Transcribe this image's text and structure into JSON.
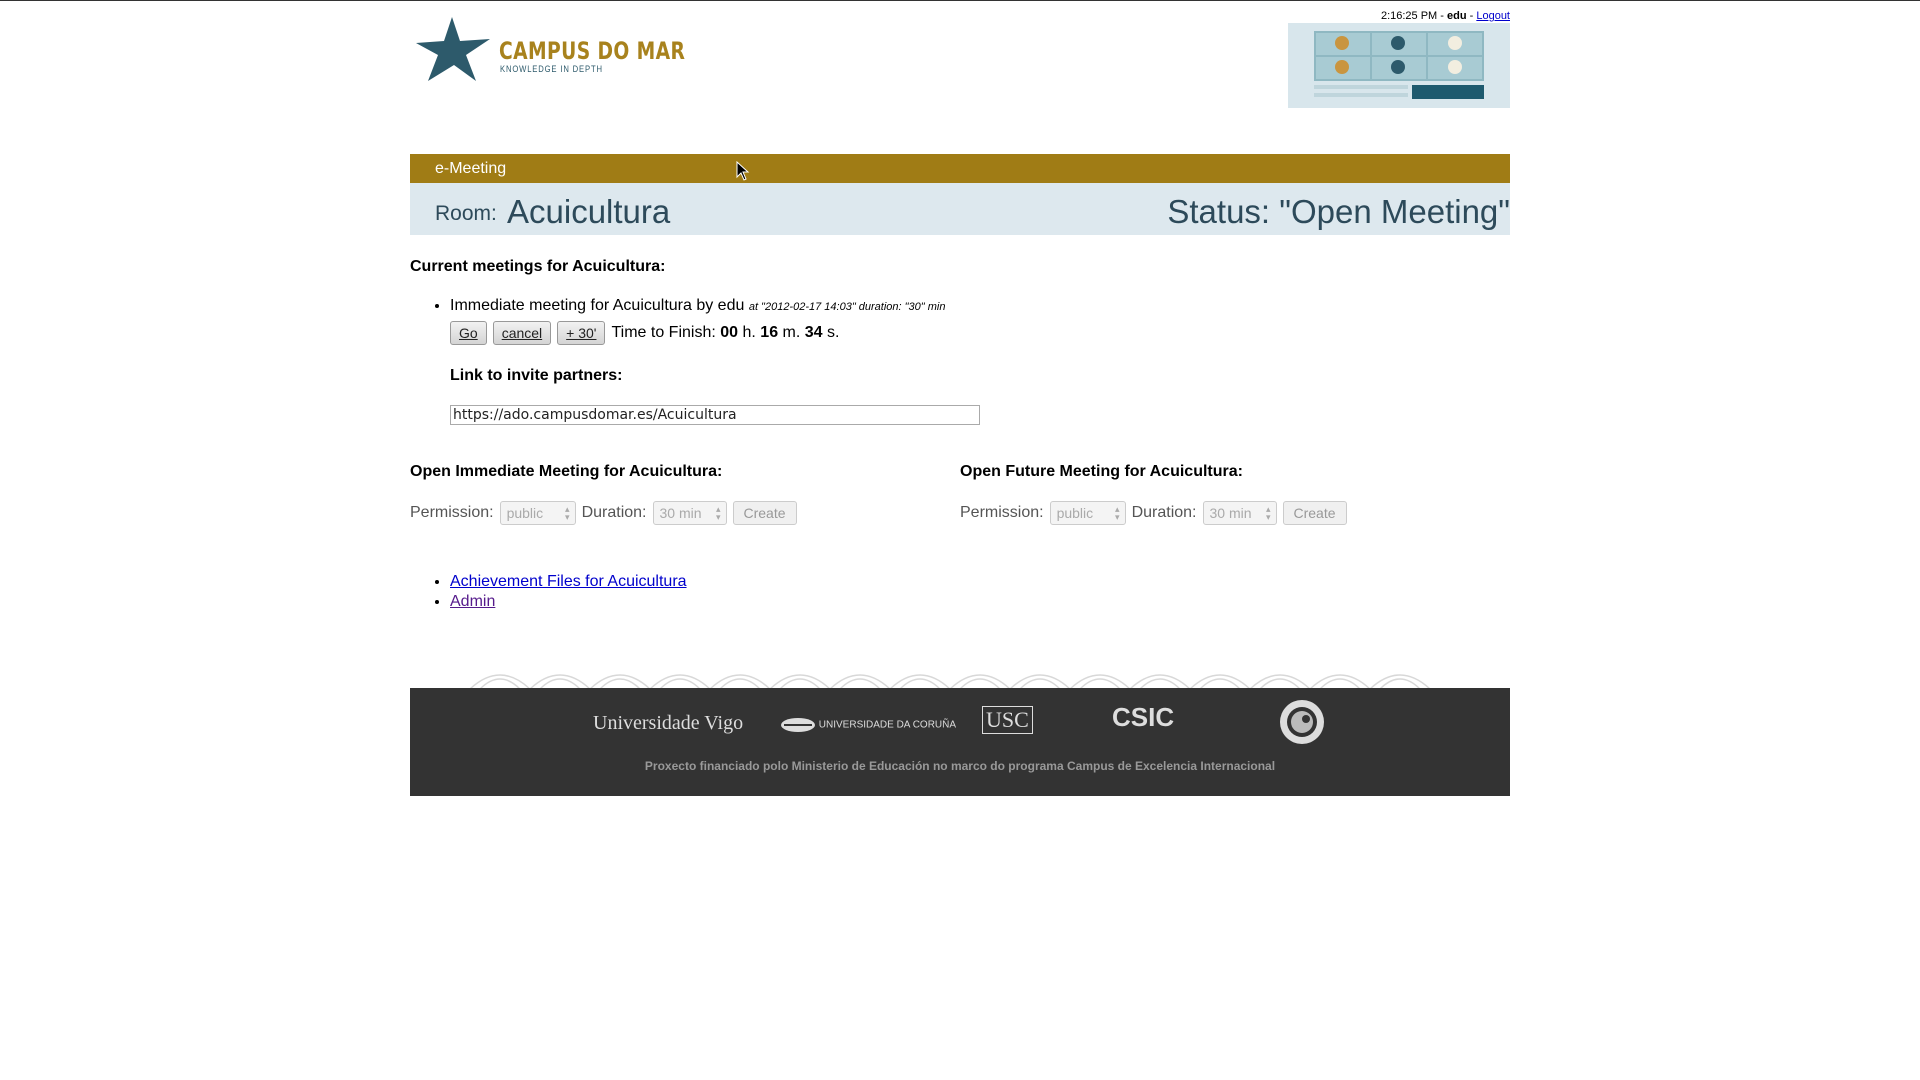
{
  "header": {
    "logo_main": "CAMPUS DO MAR",
    "logo_sub": "KNOWLEDGE IN DEPTH",
    "time": "2:16:25 PM",
    "user": "edu",
    "logout_label": "Logout"
  },
  "section": {
    "title": "e-Meeting"
  },
  "room": {
    "label": "Room:",
    "name": "Acuicultura",
    "status": "Status: \"Open Meeting\""
  },
  "current": {
    "heading": "Current meetings for Acuicultura:",
    "meeting_title": "Immediate meeting for Acuicultura by edu",
    "meeting_meta": "at \"2012-02-17 14:03\" duration: \"30\" min",
    "go_label": "Go",
    "cancel_label": "cancel",
    "extend_label": "+ 30'",
    "finish_label": "Time to Finish:",
    "hours": "00",
    "h_unit": "h.",
    "minutes": "16",
    "m_unit": "m.",
    "seconds": "34",
    "s_unit": "s.",
    "invite_heading": "Link to invite partners:",
    "invite_url": "https://ado.campusdomar.es/Acuicultura"
  },
  "immediate": {
    "heading": "Open Immediate Meeting for Acuicultura:",
    "permission_label": "Permission:",
    "permission_value": "public",
    "duration_label": "Duration:",
    "duration_value": "30 min",
    "create_label": "Create"
  },
  "future": {
    "heading": "Open Future Meeting for Acuicultura:",
    "permission_label": "Permission:",
    "permission_value": "public",
    "duration_label": "Duration:",
    "duration_value": "30 min",
    "create_label": "Create"
  },
  "links": {
    "achievement": "Achievement Files for Acuicultura",
    "admin": "Admin"
  },
  "footer": {
    "uvigo": "Universidade Vigo",
    "udc": "UNIVERSIDADE DA CORUÑA",
    "usc": "USC",
    "csic": "CSIC",
    "note": "Proxecto financiado polo Ministerio de Educación no marco do programa Campus de Excelencia Internacional"
  },
  "colors": {
    "brand_gold": "#a07c15",
    "brand_blue": "#2d5a6b",
    "room_bar": "#dde8ee",
    "footer_bg": "#333333"
  }
}
